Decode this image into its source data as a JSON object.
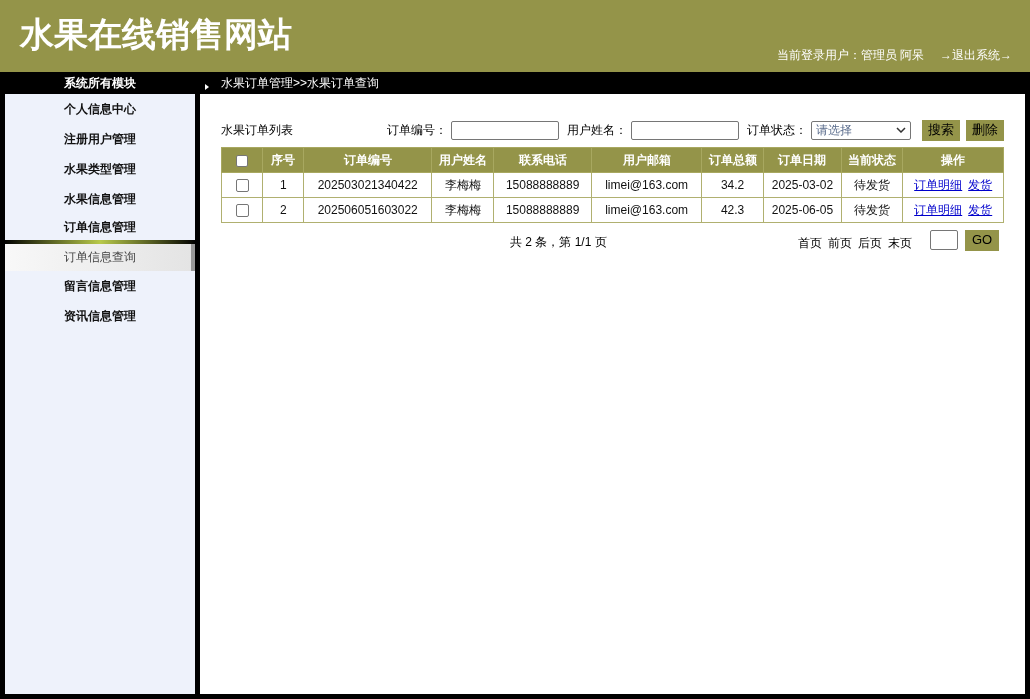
{
  "header": {
    "title": "水果在线销售网站",
    "user_label": "当前登录用户：管理员 阿呆",
    "logout": "→退出系统→"
  },
  "sidebar": {
    "title": "系统所有模块",
    "items": [
      {
        "label": "个人信息中心",
        "expanded": false
      },
      {
        "label": "注册用户管理",
        "expanded": false
      },
      {
        "label": "水果类型管理",
        "expanded": false
      },
      {
        "label": "水果信息管理",
        "expanded": false
      },
      {
        "label": "订单信息管理",
        "expanded": true,
        "children": [
          {
            "label": "订单信息查询",
            "selected": true
          }
        ]
      },
      {
        "label": "留言信息管理",
        "expanded": false
      },
      {
        "label": "资讯信息管理",
        "expanded": false
      }
    ]
  },
  "breadcrumb": "水果订单管理>>水果订单查询",
  "toolbar": {
    "list_title": "水果订单列表",
    "fields": [
      {
        "label": "订单编号：",
        "kind": "text"
      },
      {
        "label": "用户姓名：",
        "kind": "text"
      },
      {
        "label": "订单状态：",
        "kind": "select",
        "placeholder": "请选择"
      }
    ],
    "buttons": [
      "搜索",
      "删除"
    ]
  },
  "table": {
    "select_all": {
      "checked": false
    },
    "columns": [
      "序号",
      "订单编号",
      "用户姓名",
      "联系电话",
      "用户邮箱",
      "订单总额",
      "订单日期",
      "当前状态",
      "操作"
    ],
    "rows": [
      {
        "checked": false,
        "cells": [
          "1",
          "202503021340422",
          "李梅梅",
          "15088888889",
          "limei@163.com",
          "34.2",
          "2025-03-02",
          "待发货"
        ],
        "actions": [
          "订单明细",
          "发货"
        ]
      },
      {
        "checked": false,
        "cells": [
          "2",
          "202506051603022",
          "李梅梅",
          "15088888889",
          "limei@163.com",
          "42.3",
          "2025-06-05",
          "待发货"
        ],
        "actions": [
          "订单明细",
          "发货"
        ]
      }
    ]
  },
  "pagination": {
    "summary": "共 2 条，第 1/1 页",
    "links": [
      "首页",
      "前页",
      "后页",
      "末页"
    ],
    "go": "GO"
  }
}
